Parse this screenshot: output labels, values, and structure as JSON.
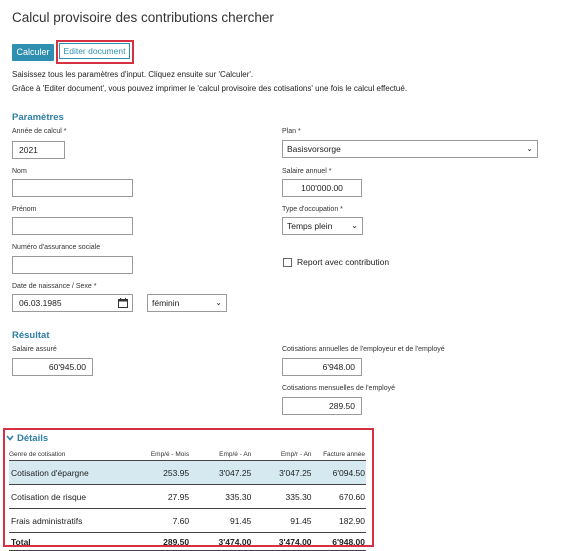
{
  "page": {
    "title": "Calcul provisoire des contributions chercher",
    "buttons": {
      "calculate": "Calculer",
      "edit_document": "Editer document"
    },
    "info_line1": "Saisissez tous les paramètres d'input. Cliquez ensuite sur 'Calculer'.",
    "info_line2": "Grâce à 'Editer document', vous pouvez imprimer le 'calcul provisoire des cotisations' une fois le calcul effectué."
  },
  "parameters": {
    "section_title": "Paramètres",
    "year_label": "Année de calcul *",
    "year_value": "2021",
    "plan_label": "Plan *",
    "plan_value": "Basisvorsorge",
    "name_label": "Nom",
    "name_value": "",
    "salary_label": "Salaire annuel *",
    "salary_value": "100'000.00",
    "firstname_label": "Prénom",
    "firstname_value": "",
    "occupation_label": "Type d'occupation *",
    "occupation_value": "Temps plein",
    "ssn_label": "Numéro d'assurance sociale",
    "ssn_value": "",
    "report_label": "Report avec contribution",
    "report_checked": false,
    "birth_label": "Date de naissance / Sexe *",
    "birth_value": "06.03.1985",
    "sex_value": "féminin"
  },
  "result": {
    "section_title": "Résultat",
    "insured_label": "Salaire assuré",
    "insured_value": "60'945.00",
    "annual_label": "Cotisations annuelles de l'employeur et de l'employé",
    "annual_value": "6'948.00",
    "monthly_label": "Cotisations mensuelles de l'employé",
    "monthly_value": "289.50"
  },
  "details": {
    "section_title": "Détails",
    "columns": [
      "Genre de cotisation",
      "Emp/é - Mois",
      "Emp/é - An",
      "Emp/r - An",
      "Facture année"
    ],
    "rows": [
      [
        "Cotisation d'épargne",
        "253.95",
        "3'047.25",
        "3'047.25",
        "6'094.50"
      ],
      [
        "Cotisation de risque",
        "27.95",
        "335.30",
        "335.30",
        "670.60"
      ],
      [
        "Frais administratifs",
        "7.60",
        "91.45",
        "91.45",
        "182.90"
      ]
    ],
    "total": [
      "Total",
      "289.50",
      "3'474.00",
      "3'474.00",
      "6'948.00"
    ]
  },
  "colors": {
    "accent": "#2e8fb0",
    "highlight": "#d63143",
    "selected_row": "#d6e9f1"
  }
}
